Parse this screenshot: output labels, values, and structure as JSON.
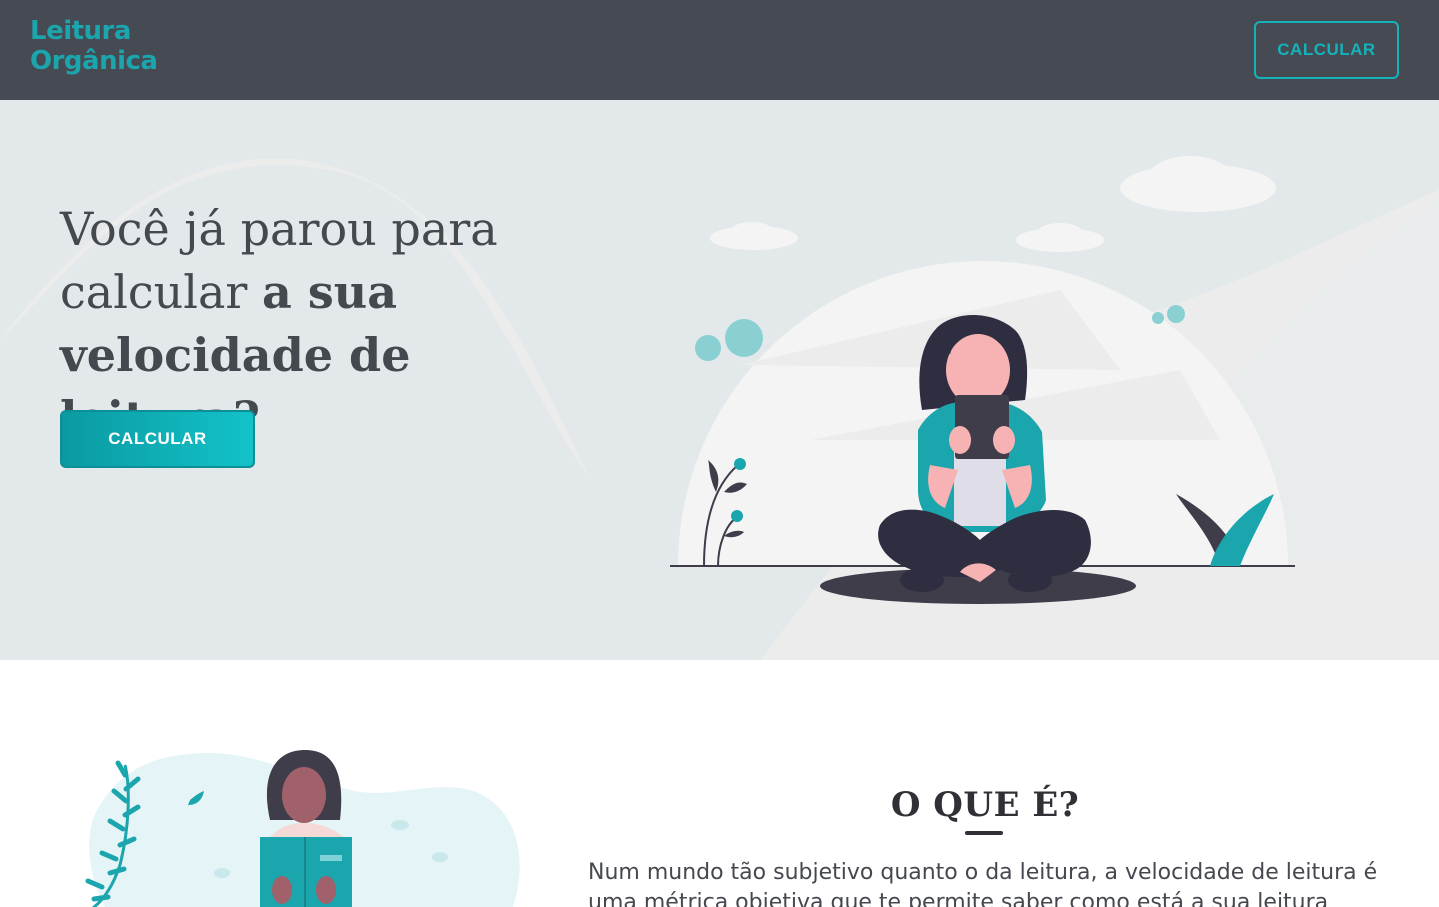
{
  "header": {
    "logo_line1": "Leitura",
    "logo_line2": "Orgânica",
    "cta_label": "CALCULAR"
  },
  "hero": {
    "title_regular": "Você já parou para calcular ",
    "title_bold": "a sua velocidade de leitura?",
    "cta_label": "CALCULAR"
  },
  "about": {
    "title": "O QUE É?",
    "text": "Num mundo tão subjetivo quanto o da leitura, a velocidade de leitura é uma métrica objetiva que te permite saber como está a sua leitura nesse"
  },
  "colors": {
    "header_bg": "#464a52",
    "accent": "#14b2ba",
    "hero_bg": "#ececec",
    "text": "#45484f"
  },
  "icons": [
    "reading-woman-illustration",
    "woman-with-book-illustration",
    "leaf-icon",
    "cloud-icon"
  ]
}
